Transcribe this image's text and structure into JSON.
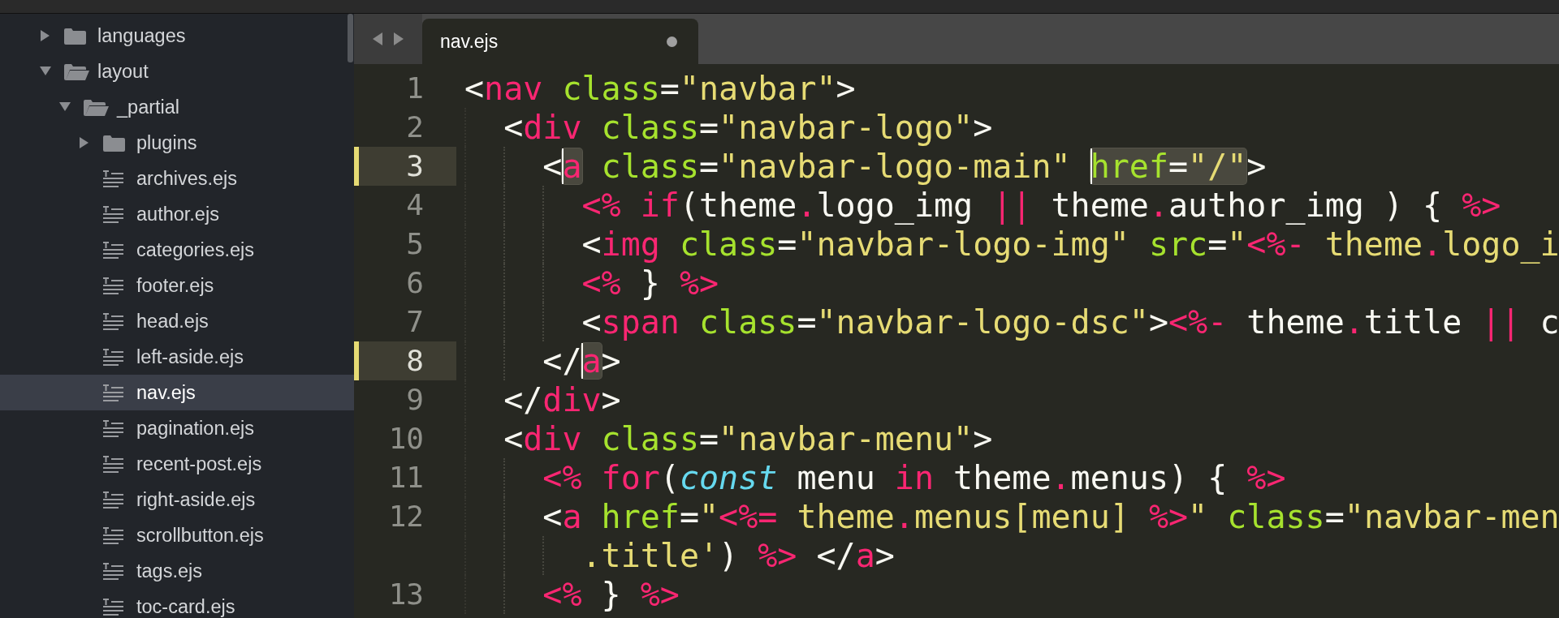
{
  "sidebar": {
    "items": [
      {
        "label": "languages",
        "kind": "folder",
        "expanded": false,
        "selected": false
      },
      {
        "label": "layout",
        "kind": "folder",
        "expanded": true,
        "selected": false,
        "children": [
          {
            "label": "_partial",
            "kind": "folder",
            "expanded": true,
            "selected": false,
            "children": [
              {
                "label": "plugins",
                "kind": "folder",
                "expanded": false,
                "selected": false
              },
              {
                "label": "archives.ejs",
                "kind": "file",
                "selected": false
              },
              {
                "label": "author.ejs",
                "kind": "file",
                "selected": false
              },
              {
                "label": "categories.ejs",
                "kind": "file",
                "selected": false
              },
              {
                "label": "footer.ejs",
                "kind": "file",
                "selected": false
              },
              {
                "label": "head.ejs",
                "kind": "file",
                "selected": false
              },
              {
                "label": "left-aside.ejs",
                "kind": "file",
                "selected": false
              },
              {
                "label": "nav.ejs",
                "kind": "file",
                "selected": true
              },
              {
                "label": "pagination.ejs",
                "kind": "file",
                "selected": false
              },
              {
                "label": "recent-post.ejs",
                "kind": "file",
                "selected": false
              },
              {
                "label": "right-aside.ejs",
                "kind": "file",
                "selected": false
              },
              {
                "label": "scrollbutton.ejs",
                "kind": "file",
                "selected": false
              },
              {
                "label": "tags.ejs",
                "kind": "file",
                "selected": false
              },
              {
                "label": "toc-card.ejs",
                "kind": "file",
                "selected": false
              }
            ]
          }
        ]
      }
    ]
  },
  "tabs": [
    {
      "label": "nav.ejs",
      "selected": true,
      "modified": true
    }
  ],
  "editor": {
    "lines": [
      {
        "number": "1",
        "active": false,
        "tokens": [
          {
            "kind": "punct",
            "text": "<"
          },
          {
            "kind": "tag",
            "text": "nav"
          },
          {
            "kind": "attr",
            "text": " class"
          },
          {
            "kind": "punct",
            "text": "="
          },
          {
            "kind": "string",
            "text": "\"navbar\""
          },
          {
            "kind": "punct",
            "text": ">"
          }
        ]
      },
      {
        "number": "2",
        "active": false,
        "tokens": [
          {
            "kind": "punct",
            "text": "  <"
          },
          {
            "kind": "tag",
            "text": "div"
          },
          {
            "kind": "attr",
            "text": " class"
          },
          {
            "kind": "punct",
            "text": "="
          },
          {
            "kind": "string",
            "text": "\"navbar-logo\""
          },
          {
            "kind": "punct",
            "text": ">"
          }
        ]
      },
      {
        "number": "3",
        "active": true,
        "tokens": [
          {
            "kind": "punct",
            "text": "    <"
          },
          {
            "highlighted": true,
            "caret_before": true,
            "parts": [
              {
                "kind": "tag",
                "text": "a"
              }
            ]
          },
          {
            "kind": "attr",
            "text": " class"
          },
          {
            "kind": "punct",
            "text": "="
          },
          {
            "kind": "string",
            "text": "\"navbar-logo-main\" "
          },
          {
            "highlighted": true,
            "caret_before": true,
            "parts": [
              {
                "kind": "attr",
                "text": "href"
              },
              {
                "kind": "punct",
                "text": "="
              },
              {
                "kind": "string",
                "text": "\"/\""
              }
            ]
          },
          {
            "kind": "punct",
            "text": ">"
          }
        ]
      },
      {
        "number": "4",
        "active": false,
        "tokens": [
          {
            "kind": "erb",
            "text": "      <%"
          },
          {
            "kind": "keyword",
            "text": " if"
          },
          {
            "kind": "punct",
            "text": "(theme"
          },
          {
            "kind": "op",
            "text": "."
          },
          {
            "kind": "punct",
            "text": "logo_img "
          },
          {
            "kind": "op",
            "text": "||"
          },
          {
            "kind": "punct",
            "text": " theme"
          },
          {
            "kind": "op",
            "text": "."
          },
          {
            "kind": "punct",
            "text": "author_img ) { "
          },
          {
            "kind": "erb",
            "text": "%>"
          }
        ]
      },
      {
        "number": "5",
        "active": false,
        "tokens": [
          {
            "kind": "punct",
            "text": "      <"
          },
          {
            "kind": "tag",
            "text": "img"
          },
          {
            "kind": "attr",
            "text": " class"
          },
          {
            "kind": "punct",
            "text": "="
          },
          {
            "kind": "string",
            "text": "\"navbar-logo-img\""
          },
          {
            "kind": "attr",
            "text": " src"
          },
          {
            "kind": "punct",
            "text": "="
          },
          {
            "kind": "string",
            "text": "\""
          },
          {
            "kind": "erb",
            "text": "<%-"
          },
          {
            "kind": "string",
            "text": " theme"
          },
          {
            "kind": "op",
            "text": "."
          },
          {
            "kind": "string",
            "text": "logo_i"
          }
        ]
      },
      {
        "number": "6",
        "active": false,
        "tokens": [
          {
            "kind": "erb",
            "text": "      <%"
          },
          {
            "kind": "punct",
            "text": " } "
          },
          {
            "kind": "erb",
            "text": "%>"
          }
        ]
      },
      {
        "number": "7",
        "active": false,
        "tokens": [
          {
            "kind": "punct",
            "text": "      <"
          },
          {
            "kind": "tag",
            "text": "span"
          },
          {
            "kind": "attr",
            "text": " class"
          },
          {
            "kind": "punct",
            "text": "="
          },
          {
            "kind": "string",
            "text": "\"navbar-logo-dsc\""
          },
          {
            "kind": "punct",
            "text": ">"
          },
          {
            "kind": "erb",
            "text": "<%-"
          },
          {
            "kind": "punct",
            "text": " theme"
          },
          {
            "kind": "op",
            "text": "."
          },
          {
            "kind": "punct",
            "text": "title "
          },
          {
            "kind": "op",
            "text": "||"
          },
          {
            "kind": "punct",
            "text": " c"
          }
        ]
      },
      {
        "number": "8",
        "active": true,
        "tokens": [
          {
            "kind": "punct",
            "text": "    </"
          },
          {
            "highlighted": true,
            "caret_before": true,
            "parts": [
              {
                "kind": "tag",
                "text": "a"
              }
            ]
          },
          {
            "kind": "punct",
            "text": ">"
          }
        ]
      },
      {
        "number": "9",
        "active": false,
        "tokens": [
          {
            "kind": "punct",
            "text": "  </"
          },
          {
            "kind": "tag",
            "text": "div"
          },
          {
            "kind": "punct",
            "text": ">"
          }
        ]
      },
      {
        "number": "10",
        "active": false,
        "tokens": [
          {
            "kind": "punct",
            "text": "  <"
          },
          {
            "kind": "tag",
            "text": "div"
          },
          {
            "kind": "attr",
            "text": " class"
          },
          {
            "kind": "punct",
            "text": "="
          },
          {
            "kind": "string",
            "text": "\"navbar-menu\""
          },
          {
            "kind": "punct",
            "text": ">"
          }
        ]
      },
      {
        "number": "11",
        "active": false,
        "tokens": [
          {
            "kind": "erb",
            "text": "    <%"
          },
          {
            "kind": "keyword",
            "text": " for"
          },
          {
            "kind": "punct",
            "text": "("
          },
          {
            "kind": "storage",
            "text": "const"
          },
          {
            "kind": "punct",
            "text": " menu "
          },
          {
            "kind": "keyword",
            "text": "in"
          },
          {
            "kind": "punct",
            "text": " theme"
          },
          {
            "kind": "op",
            "text": "."
          },
          {
            "kind": "punct",
            "text": "menus) { "
          },
          {
            "kind": "erb",
            "text": "%>"
          }
        ]
      },
      {
        "number": "12",
        "active": false,
        "tokens": [
          {
            "kind": "punct",
            "text": "    <"
          },
          {
            "kind": "tag",
            "text": "a"
          },
          {
            "kind": "attr",
            "text": " href"
          },
          {
            "kind": "punct",
            "text": "="
          },
          {
            "kind": "string",
            "text": "\""
          },
          {
            "kind": "erb",
            "text": "<%="
          },
          {
            "kind": "string",
            "text": " theme"
          },
          {
            "kind": "op",
            "text": "."
          },
          {
            "kind": "string",
            "text": "menus[menu] "
          },
          {
            "kind": "erb",
            "text": "%>"
          },
          {
            "kind": "string",
            "text": "\""
          },
          {
            "kind": "attr",
            "text": " class"
          },
          {
            "kind": "punct",
            "text": "="
          },
          {
            "kind": "string",
            "text": "\"navbar-men"
          }
        ],
        "wrap": {
          "tokens": [
            {
              "kind": "string",
              "text": "      .title'"
            },
            {
              "kind": "punct",
              "text": ") "
            },
            {
              "kind": "erb",
              "text": "%>"
            },
            {
              "kind": "punct",
              "text": " </"
            },
            {
              "kind": "tag",
              "text": "a"
            },
            {
              "kind": "punct",
              "text": ">"
            }
          ]
        }
      },
      {
        "number": "13",
        "active": false,
        "tokens": [
          {
            "kind": "erb",
            "text": "    <%"
          },
          {
            "kind": "punct",
            "text": " } "
          },
          {
            "kind": "erb",
            "text": "%>"
          }
        ]
      }
    ]
  }
}
